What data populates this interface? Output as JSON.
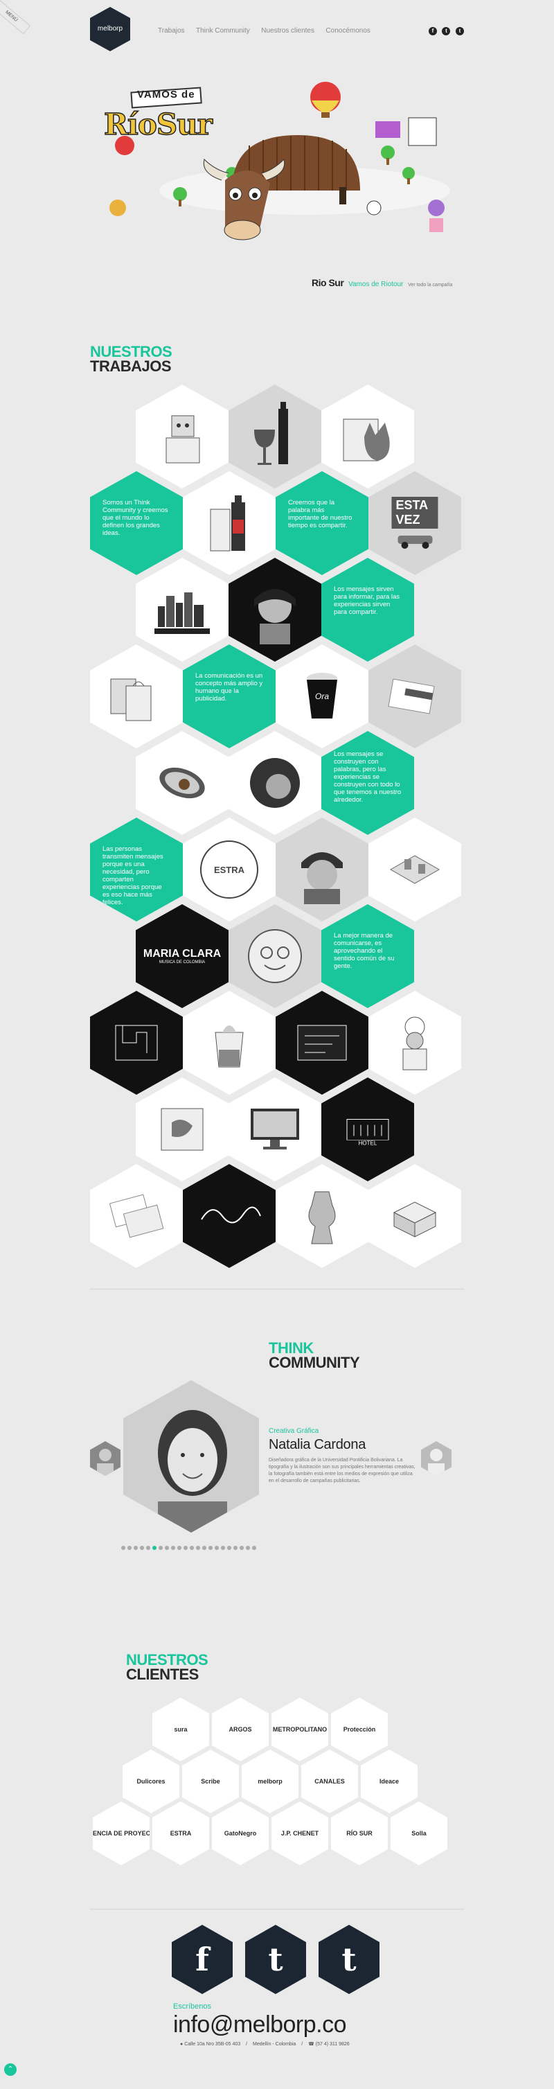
{
  "header": {
    "logo_text": "melborp",
    "nav": [
      "Trabajos",
      "Think Community",
      "Nuestros clientes",
      "Conocémonos"
    ],
    "social": [
      "f",
      "t",
      "t"
    ],
    "corner_badge": "MENÚ"
  },
  "hero": {
    "title_top": "VAMOS de",
    "title_main": "RíoSur",
    "caption_brand": "Rio Sur",
    "caption_text": "Vamos de Riotour",
    "caption_link": "Ver todo la campaña"
  },
  "works": {
    "title_accent": "NUESTROS",
    "title_main": "TRABAJOS",
    "texts": {
      "t1": "Somos un Think Community y creemos que el mundo lo definen los grandes ideas.",
      "t2": "Creemos que la palabra más importante de nuestro tiempo es compartir.",
      "t3": "Los mensajes sirven para informar, para las experiencias sirven para compartir.",
      "t4": "La comunicación es un concepto más amplio y humano que la publicidad.",
      "t5": "Los mensajes se construyen con palabras, pero las experiencias se construyen con todo lo que tenemos a nuestro alrededor.",
      "t6": "Las personas transmiten mensajes porque es una necesidad, pero comparten experiencias porque es eso hace más felices.",
      "t7": "La mejor manera de comunicarse, es aprovechando el sentido común de su gente."
    },
    "labels": {
      "esta_vez": "ESTA VEZ",
      "maria_clara": "MARIA CLARA",
      "maria_sub": "MUSICA DE COLOMBIA",
      "estra": "ESTRA",
      "ora": "Ora",
      "hotel": "HOTEL"
    }
  },
  "community": {
    "title_accent": "THINK",
    "title_main": "COMMUNITY",
    "role": "Creativa Gráfica",
    "name": "Natalia Cardona",
    "bio": "Diseñadora gráfica de la Universidad Pontificia Bolivariana. La tipografía y la ilustración son sus principales herramientas creativas, la fotografía también está entre los medios de expresión que utiliza en el desarrollo de campañas publicitarias.",
    "dots_total": 22,
    "dots_active": 5
  },
  "clients": {
    "title_accent": "NUESTROS",
    "title_main": "CLIENTES",
    "row1": [
      "sura",
      "ARGOS",
      "METROPOLITANO",
      "Protección"
    ],
    "row2": [
      "Dulicores",
      "Scribe",
      "melborp",
      "CANALES",
      "Ideace"
    ],
    "row3": [
      "GERENCIA DE PROYECTOS",
      "ESTRA",
      "GatoNegro",
      "J.P. CHENET",
      "RÍO SUR",
      "Solla"
    ]
  },
  "footer": {
    "social": [
      "f",
      "t",
      "t"
    ],
    "write_us": "Escríbenos",
    "email": "info@melborp.co",
    "address": "Calle 10a Nro 35B-05 403",
    "city": "Medellín - Colombia",
    "phone": "(57 4) 311 9826"
  },
  "colors": {
    "accent": "#19c59b",
    "dark": "#1b2632"
  }
}
